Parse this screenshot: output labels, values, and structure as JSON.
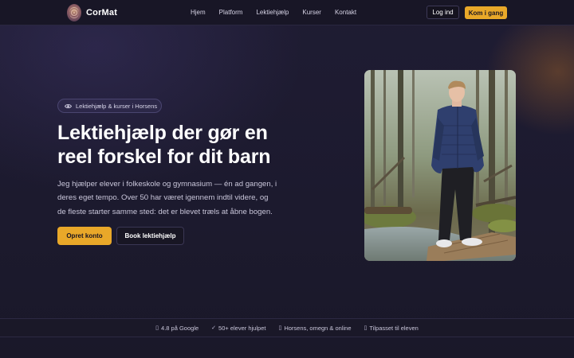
{
  "nav": {
    "brand": "CorMat",
    "links": [
      "Hjem",
      "Platform",
      "Lektiehjælp",
      "Kurser",
      "Kontakt"
    ],
    "login_label": "Log ind",
    "cta_label": "Kom i gang"
  },
  "hero": {
    "badge": "Lektiehjælp & kurser i Horsens",
    "title_lines": [
      "Lektiehjælp der gør en",
      "reel forskel for dit barn"
    ],
    "description_lines": [
      "Jeg hjælper elever i folkeskole og gymnasium — én ad gangen, i",
      "deres eget tempo. Over 50 har været igennem indtil videre, og",
      "de fleste starter samme sted: det er blevet træls at åbne bogen."
    ],
    "primary_button": "Opret konto",
    "secondary_button": "Book lektiehjælp"
  },
  "strip": {
    "items": [
      {
        "icon": "star-icon",
        "glyph": "▯",
        "label": "4.8 på Google"
      },
      {
        "icon": "check-icon",
        "glyph": "✓",
        "label": "50+ elever hjulpet"
      },
      {
        "icon": "location-icon",
        "glyph": "▯",
        "label": "Horsens, omegn & online"
      },
      {
        "icon": "user-icon",
        "glyph": "▯",
        "label": "Tilpasset til eleven"
      }
    ]
  },
  "colors": {
    "accent": "#e9a829",
    "background": "#1c1a2e",
    "nav_background": "#181626"
  }
}
